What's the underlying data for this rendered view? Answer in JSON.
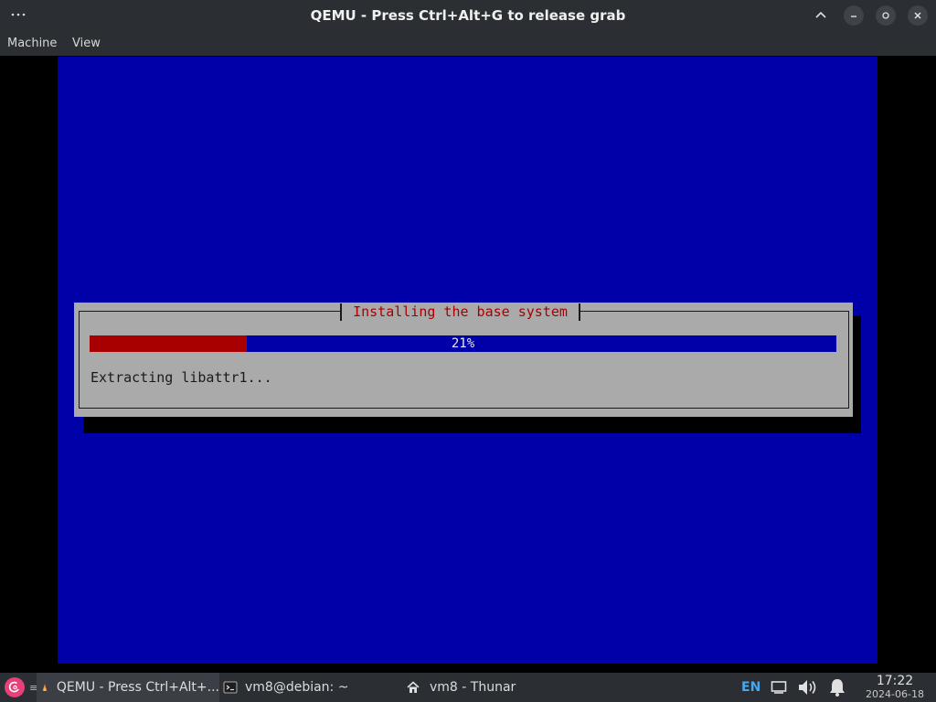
{
  "window": {
    "title": "QEMU - Press Ctrl+Alt+G to release grab",
    "menu_icon": "more-horizontal-icon",
    "controls": [
      "shade-up-icon",
      "minimize-icon",
      "restore-icon",
      "close-icon"
    ]
  },
  "menubar": {
    "items": [
      {
        "label": "Machine"
      },
      {
        "label": "View"
      }
    ]
  },
  "installer": {
    "dialog_title": "Installing the base system",
    "progress_percent": 21,
    "progress_label": "21%",
    "status": "Extracting libattr1...",
    "colors": {
      "screen_bg": "#0000a8",
      "dialog_bg": "#aaaaaa",
      "title_fg": "#a80000",
      "progress_fill": "#a80000",
      "progress_track": "#0000a8"
    }
  },
  "taskbar": {
    "start_icon": "debian-swirl-icon",
    "workspace_label": "≡",
    "tasks": [
      {
        "label": "QEMU - Press Ctrl+Alt+...",
        "icon": "qemu-icon",
        "active": true
      },
      {
        "label": "vm8@debian: ~",
        "icon": "terminal-icon",
        "active": false
      },
      {
        "label": "vm8 - Thunar",
        "icon": "home-icon",
        "active": false
      }
    ],
    "tray": {
      "keyboard_layout": "EN",
      "icons": [
        "display-icon",
        "volume-icon",
        "notification-bell-icon"
      ]
    },
    "clock": {
      "time": "17:22",
      "date": "2024-06-18"
    }
  }
}
